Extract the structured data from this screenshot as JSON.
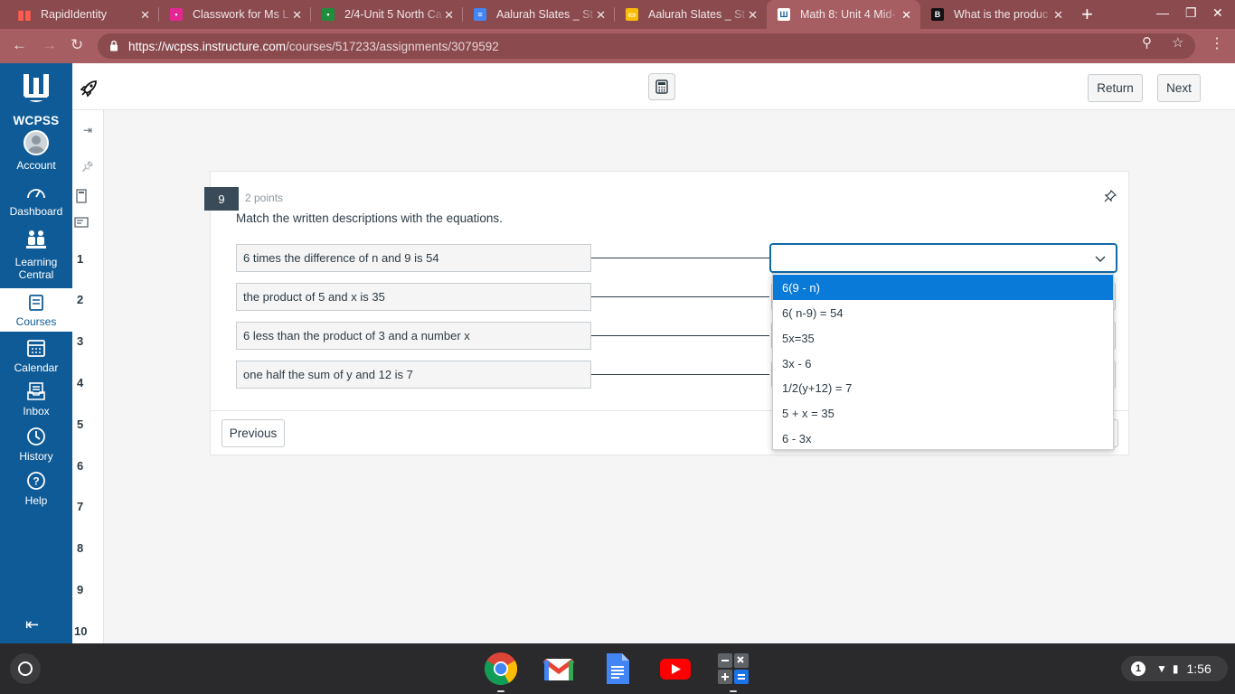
{
  "browser": {
    "tabs": [
      {
        "title": "RapidIdentity",
        "favicon_color": "#d93025"
      },
      {
        "title": "Classwork for Ms L",
        "favicon_color": "#e52592"
      },
      {
        "title": "2/4-Unit 5 North Ca",
        "favicon_color": "#1e8e3e"
      },
      {
        "title": "Aalurah Slates _ St",
        "favicon_color": "#4285f4"
      },
      {
        "title": "Aalurah Slates _ St",
        "favicon_color": "#fbbc04"
      },
      {
        "title": "Math 8: Unit 4 Mid-",
        "favicon_color": "#0f5b97"
      },
      {
        "title": "What is the produc",
        "favicon_color": "#111111"
      }
    ],
    "url_host": "https://wcpss.instructure.com",
    "url_path": "/courses/517233/assignments/3079592"
  },
  "global_nav": {
    "logo_text": "WCPSS",
    "items": [
      {
        "label": "Account",
        "icon": "account-icon"
      },
      {
        "label": "Dashboard",
        "icon": "dashboard-icon"
      },
      {
        "label": "Learning Central",
        "icon": "learning-central-icon"
      },
      {
        "label": "Courses",
        "icon": "courses-icon"
      },
      {
        "label": "Calendar",
        "icon": "calendar-icon"
      },
      {
        "label": "Inbox",
        "icon": "inbox-icon"
      },
      {
        "label": "History",
        "icon": "history-icon"
      },
      {
        "label": "Help",
        "icon": "help-icon"
      }
    ],
    "active": "Courses",
    "brand_color": "#0f5b97"
  },
  "topbar": {
    "return_label": "Return",
    "next_label": "Next"
  },
  "question_nav": {
    "numbers": [
      "1",
      "2",
      "3",
      "4",
      "5",
      "6",
      "7",
      "8",
      "9",
      "10"
    ]
  },
  "question": {
    "number": "9",
    "points": "2 points",
    "prompt": "Match the written descriptions with the equations.",
    "descriptions": [
      "6 times the difference of n and 9 is 54",
      "the product of 5 and x is 35",
      "6 less than the product of 3 and a number x",
      "one half the sum of y and 12 is 7"
    ],
    "dropdown_options": [
      "6(9 - n)",
      "6( n-9) = 54",
      "5x=35",
      "3x - 6",
      "1/2(y+12) = 7",
      "5 + x = 35",
      "6 - 3x"
    ],
    "highlighted_option": "6(9 - n)",
    "previous_label": "Previous"
  },
  "shelf": {
    "apps": [
      "chrome-icon",
      "gmail-icon",
      "docs-icon",
      "youtube-icon",
      "calculator-icon"
    ],
    "notification_count": "1",
    "time": "1:56"
  }
}
